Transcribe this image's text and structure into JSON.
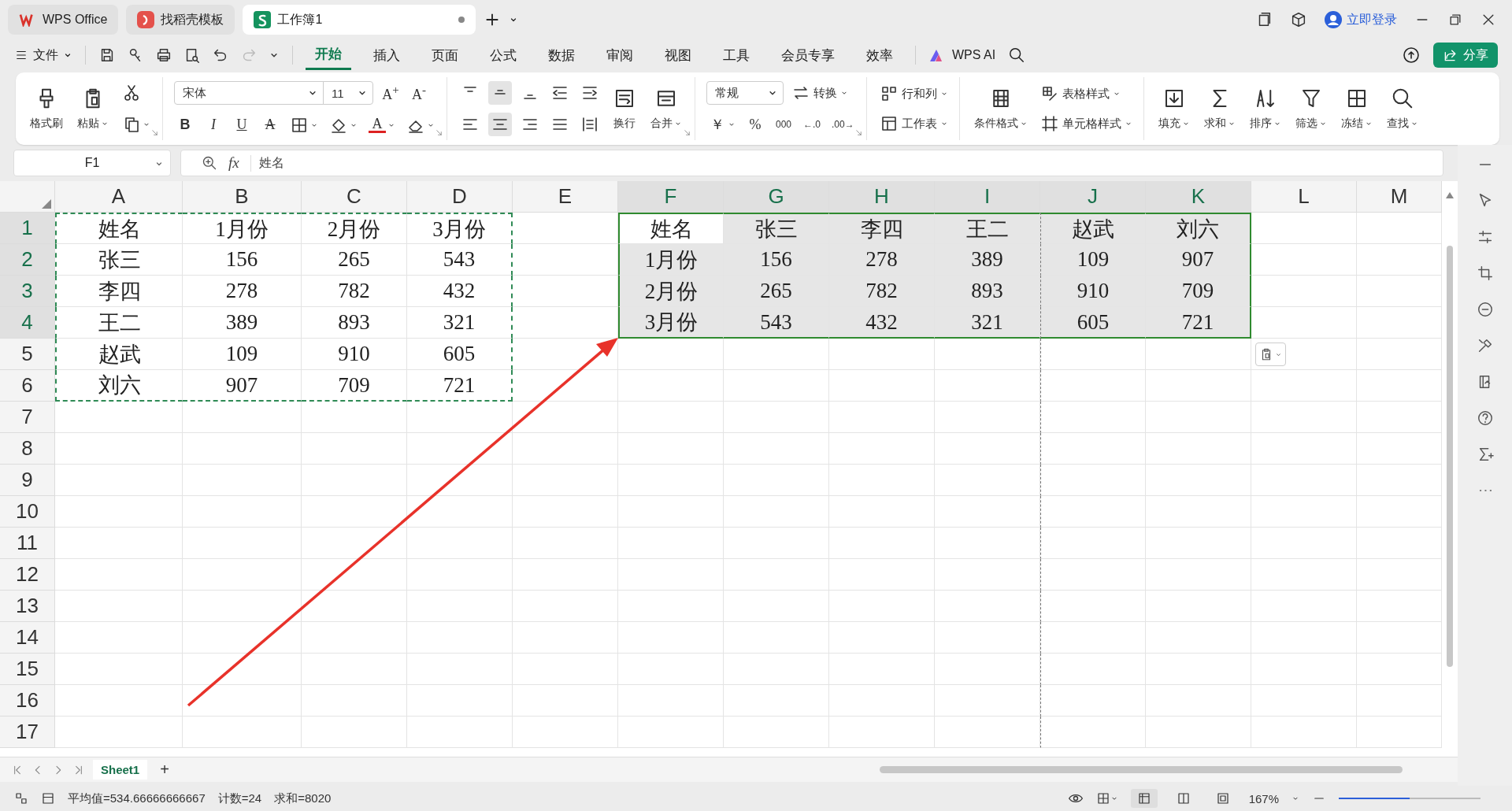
{
  "tabs": [
    {
      "label": "WPS Office",
      "kind": "wps",
      "selected": false
    },
    {
      "label": "找稻壳模板",
      "kind": "template",
      "selected": false
    },
    {
      "label": "工作簿1",
      "kind": "sheet",
      "selected": true,
      "unsaved": true
    }
  ],
  "title_bar": {
    "login": "立即登录"
  },
  "menu": {
    "file": "文件",
    "redo_disabled": true,
    "ribbon_tabs": [
      {
        "label": "开始",
        "selected": true
      },
      {
        "label": "插入",
        "selected": false
      },
      {
        "label": "页面",
        "selected": false
      },
      {
        "label": "公式",
        "selected": false
      },
      {
        "label": "数据",
        "selected": false
      },
      {
        "label": "审阅",
        "selected": false
      },
      {
        "label": "视图",
        "selected": false
      },
      {
        "label": "工具",
        "selected": false
      },
      {
        "label": "会员专享",
        "selected": false
      },
      {
        "label": "效率",
        "selected": false
      }
    ],
    "ai": "WPS AI",
    "share": "分享"
  },
  "ribbon": {
    "groups": [
      {
        "launcher": true,
        "columns": [
          {
            "kind": "large",
            "label": "格式刷",
            "dropdown": false
          },
          {
            "kind": "large",
            "label": "粘贴",
            "dropdown": true
          },
          {
            "kind": "stack",
            "rows": [
              [
                {
                  "kind": "icon",
                  "dropdown": false,
                  "selected": false
                }
              ],
              [
                {
                  "kind": "icon",
                  "dropdown": true,
                  "selected": false
                }
              ]
            ]
          }
        ]
      },
      {
        "launcher": true,
        "columns": [
          {
            "kind": "stack",
            "rows": [
              [
                {
                  "kind": "font-select",
                  "value": "宋体"
                },
                {
                  "kind": "size-select",
                  "value": "11"
                },
                {
                  "kind": "text",
                  "text": "A$^{+}$",
                  "dropdown": false
                },
                {
                  "kind": "text",
                  "text": "A$^{-}$",
                  "dropdown": false
                }
              ],
              [
                {
                  "kind": "bold",
                  "text": "B",
                  "dropdown": false
                },
                {
                  "kind": "italic",
                  "text": "I",
                  "dropdown": false
                },
                {
                  "kind": "underline",
                  "text": "U",
                  "dropdown": false
                },
                {
                  "kind": "strike",
                  "text": "A",
                  "dropdown": false
                },
                {
                  "kind": "icon",
                  "dropdown": true,
                  "selected": false
                },
                {
                  "kind": "icon",
                  "dropdown": true,
                  "selected": false
                },
                {
                  "kind": "colortext",
                  "text": "A",
                  "dropdown": true
                },
                {
                  "kind": "icon",
                  "dropdown": true,
                  "selected": false
                }
              ]
            ]
          }
        ]
      },
      {
        "launcher": true,
        "columns": [
          {
            "kind": "stack",
            "rows": [
              [
                {
                  "kind": "icon",
                  "dropdown": false,
                  "selected": false
                },
                {
                  "kind": "icon",
                  "dropdown": false,
                  "selected": true
                },
                {
                  "kind": "icon",
                  "dropdown": false,
                  "selected": false
                },
                {
                  "kind": "icon",
                  "dropdown": false,
                  "selected": false
                },
                {
                  "kind": "icon",
                  "dropdown": false,
                  "selected": false
                }
              ],
              [
                {
                  "kind": "icon",
                  "dropdown": false,
                  "selected": false
                },
                {
                  "kind": "icon",
                  "dropdown": false,
                  "selected": true
                },
                {
                  "kind": "icon",
                  "dropdown": false,
                  "selected": false
                },
                {
                  "kind": "icon",
                  "dropdown": false,
                  "selected": false
                },
                {
                  "kind": "icon",
                  "dropdown": false,
                  "selected": false
                }
              ]
            ]
          },
          {
            "kind": "large",
            "label": "换行",
            "dropdown": false
          },
          {
            "kind": "large",
            "label": "合并",
            "dropdown": true
          }
        ]
      },
      {
        "launcher": true,
        "columns": [
          {
            "kind": "stack",
            "rows": [
              [
                {
                  "kind": "format-select",
                  "value": "常规"
                },
                {
                  "kind": "labeled",
                  "label": "转换",
                  "dropdown": true
                }
              ],
              [
                {
                  "kind": "text",
                  "text": "￥",
                  "dropdown": true
                },
                {
                  "kind": "text",
                  "text": "%",
                  "dropdown": false
                },
                {
                  "kind": "smalltext",
                  "text": "000",
                  "dropdown": false
                },
                {
                  "kind": "smalltext",
                  "text": "←.0",
                  "dropdown": false
                },
                {
                  "kind": "smalltext",
                  "text": ".00→",
                  "dropdown": false
                }
              ]
            ]
          }
        ]
      },
      {
        "columns": [
          {
            "kind": "stack",
            "rows": [
              [
                {
                  "kind": "labeled",
                  "label": "行和列",
                  "dropdown": true
                }
              ],
              [
                {
                  "kind": "labeled",
                  "label": "工作表",
                  "dropdown": true
                }
              ]
            ]
          }
        ]
      },
      {
        "columns": [
          {
            "kind": "large",
            "label": "条件格式",
            "dropdown": true
          },
          {
            "kind": "stack",
            "rows": [
              [
                {
                  "kind": "labeled",
                  "label": "表格样式",
                  "dropdown": true
                }
              ],
              [
                {
                  "kind": "labeled",
                  "label": "单元格样式",
                  "dropdown": true
                }
              ]
            ]
          }
        ]
      },
      {
        "columns": [
          {
            "kind": "large",
            "label": "填充",
            "dropdown": true
          },
          {
            "kind": "large",
            "label": "求和",
            "dropdown": true
          },
          {
            "kind": "large",
            "label": "排序",
            "dropdown": true
          },
          {
            "kind": "large",
            "label": "筛选",
            "dropdown": true
          },
          {
            "kind": "large",
            "label": "冻结",
            "dropdown": true
          },
          {
            "kind": "large",
            "label": "查找",
            "dropdown": true
          }
        ]
      }
    ]
  },
  "formula_bar": {
    "cell_ref": "F1",
    "function_label": "fx",
    "value": "姓名"
  },
  "sheet": {
    "columns": [
      {
        "label": "A",
        "selected": false,
        "copied": true,
        "page_break": false
      },
      {
        "label": "B",
        "selected": false,
        "copied": true,
        "page_break": false
      },
      {
        "label": "C",
        "selected": false,
        "copied": true,
        "page_break": false
      },
      {
        "label": "D",
        "selected": false,
        "copied": true,
        "page_break": false
      },
      {
        "label": "E",
        "selected": false,
        "copied": false,
        "page_break": false
      },
      {
        "label": "F",
        "selected": true,
        "copied": false,
        "page_break": false
      },
      {
        "label": "G",
        "selected": true,
        "copied": false,
        "page_break": false
      },
      {
        "label": "H",
        "selected": true,
        "copied": false,
        "page_break": false
      },
      {
        "label": "I",
        "selected": true,
        "copied": false,
        "page_break": false
      },
      {
        "label": "J",
        "selected": true,
        "copied": false,
        "page_break": true
      },
      {
        "label": "K",
        "selected": true,
        "copied": false,
        "page_break": false
      },
      {
        "label": "L",
        "selected": false,
        "copied": false,
        "page_break": false
      },
      {
        "label": "M",
        "selected": false,
        "copied": false,
        "page_break": false
      }
    ],
    "rows": [
      {
        "label": "1",
        "selected": true,
        "copied": true,
        "cells": [
          "姓名",
          "1月份",
          "2月份",
          "3月份",
          null,
          "姓名",
          "张三",
          "李四",
          "王二",
          "赵武",
          "刘六"
        ]
      },
      {
        "label": "2",
        "selected": true,
        "copied": true,
        "cells": [
          "张三",
          "156",
          "265",
          "543",
          null,
          "1月份",
          "156",
          "278",
          "389",
          "109",
          "907"
        ]
      },
      {
        "label": "3",
        "selected": true,
        "copied": true,
        "cells": [
          "李四",
          "278",
          "782",
          "432",
          null,
          "2月份",
          "265",
          "782",
          "893",
          "910",
          "709"
        ]
      },
      {
        "label": "4",
        "selected": true,
        "copied": true,
        "cells": [
          "王二",
          "389",
          "893",
          "321",
          null,
          "3月份",
          "543",
          "432",
          "321",
          "605",
          "721"
        ]
      },
      {
        "label": "5",
        "selected": false,
        "copied": true,
        "cells": [
          "赵武",
          "109",
          "910",
          "605"
        ]
      },
      {
        "label": "6",
        "selected": false,
        "copied": true,
        "cells": [
          "刘六",
          "907",
          "709",
          "721"
        ]
      },
      {
        "label": "7",
        "selected": false,
        "copied": false
      },
      {
        "label": "8",
        "selected": false,
        "copied": false
      },
      {
        "label": "9",
        "selected": false,
        "copied": false
      },
      {
        "label": "10",
        "selected": false,
        "copied": false
      },
      {
        "label": "11",
        "selected": false,
        "copied": false
      },
      {
        "label": "12",
        "selected": false,
        "copied": false
      },
      {
        "label": "13",
        "selected": false,
        "copied": false
      },
      {
        "label": "14",
        "selected": false,
        "copied": false
      },
      {
        "label": "15",
        "selected": false,
        "copied": false
      },
      {
        "label": "16",
        "selected": false,
        "copied": false
      },
      {
        "label": "17",
        "selected": false,
        "copied": false
      }
    ]
  },
  "sheet_tabs": [
    {
      "label": "Sheet1",
      "selected": true
    }
  ],
  "add_sheet": "+",
  "status_bar": {
    "average": "平均值=534.66666666667",
    "count": "计数=24",
    "sum": "求和=8020",
    "zoom": "167%",
    "zoom_slider": {
      "level": 0.5
    },
    "views": [
      {
        "selected": true
      },
      {
        "selected": false
      },
      {
        "selected": false
      }
    ]
  }
}
